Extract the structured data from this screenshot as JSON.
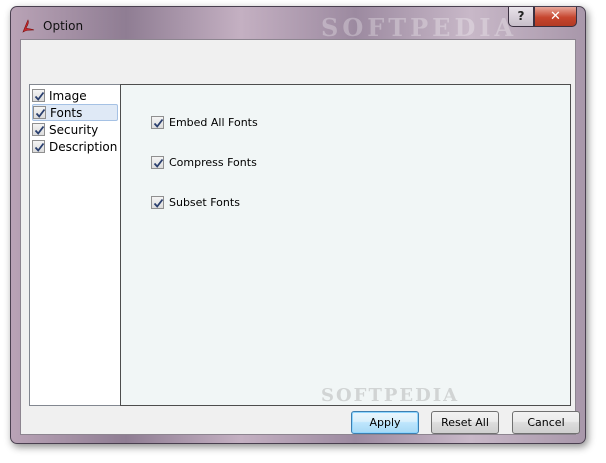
{
  "window": {
    "title": "Option",
    "help_label": "?",
    "close_label": "✕",
    "watermark": "SOFTPEDIA"
  },
  "tree": {
    "items": [
      {
        "label": "Image",
        "checked": true,
        "selected": false
      },
      {
        "label": "Fonts",
        "checked": true,
        "selected": true
      },
      {
        "label": "Security",
        "checked": true,
        "selected": false
      },
      {
        "label": "Description",
        "checked": true,
        "selected": false
      }
    ]
  },
  "fonts_panel": {
    "options": [
      {
        "label": "Embed All Fonts",
        "checked": true
      },
      {
        "label": "Compress Fonts",
        "checked": true
      },
      {
        "label": "Subset Fonts",
        "checked": true
      }
    ]
  },
  "buttons": {
    "apply": "Apply",
    "reset_all": "Reset All",
    "cancel": "Cancel"
  },
  "icons": {
    "app": "pdf-app-icon",
    "check": "check-icon"
  },
  "colors": {
    "panel_bg": "#f1f6f6",
    "selection_bg": "#dfe9f6",
    "close_red": "#c6452e"
  }
}
